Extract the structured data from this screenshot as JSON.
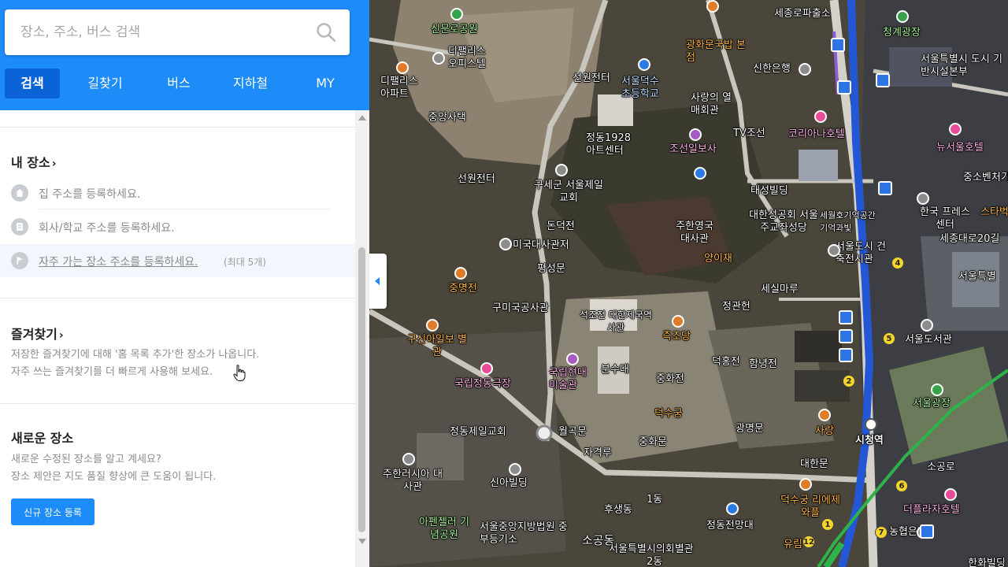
{
  "search": {
    "placeholder": "장소, 주소, 버스 검색"
  },
  "tabs": [
    {
      "label": "검색",
      "active": true
    },
    {
      "label": "길찾기"
    },
    {
      "label": "버스"
    },
    {
      "label": "지하철"
    },
    {
      "label": "MY"
    }
  ],
  "my_places": {
    "title": "내 장소",
    "items": [
      {
        "icon": "home-icon",
        "text": "집 주소를 등록하세요."
      },
      {
        "icon": "office-icon",
        "text": "회사/학교 주소를 등록하세요."
      },
      {
        "icon": "flag-icon",
        "text": "자주 가는 장소 주소를 등록하세요.",
        "count": "(최대 5개)"
      }
    ]
  },
  "favorites": {
    "title": "즐겨찾기",
    "desc1": "저장한 즐겨찾기에 대해 '홈 목록 추가'한 장소가 나옵니다.",
    "desc2": "자주 쓰는 즐겨찾기를 더 빠르게 사용해 보세요."
  },
  "new_place": {
    "title": "새로운 장소",
    "desc1": "새로운 수정된 장소를 알고 계세요?",
    "desc2": "장소 제안은 지도 품질 향상에 큰 도움이 됩니다.",
    "button": "신규 장소 등록"
  },
  "colors": {
    "brand": "#1d8bf8",
    "active_tab": "#0b63d8"
  },
  "map_labels": [
    "신문로공원",
    "디팰리스 오피스텔",
    "디팰리스 아파트",
    "중앙사택",
    "경희궁의 아침",
    "선원전터",
    "서울덕수 초등학교",
    "사랑의 열매회관",
    "신한은행",
    "세종로파출소",
    "청계광장",
    "서울특별시 도시 기반시설본부",
    "광화문국밥 본점",
    "정동1928 아트센터",
    "조선일보사",
    "TV조선",
    "코리아나호텔",
    "뉴서울호텔",
    "구세군 서울제일교회",
    "고종의길",
    "태성빌딩",
    "대한성공회 서울주교좌성당",
    "세월호기억공간 기억과빛",
    "서울도시 건축전시관",
    "한국 프레스센터",
    "세종대로20길",
    "서울특별",
    "중소벤처기",
    "스타벅스",
    "돈덕전",
    "주한영국 대사관",
    "양이재",
    "미국대사관저",
    "평성문",
    "중명전",
    "세실마루",
    "정관헌",
    "구미국공사관",
    "석조전 대한제국역사관",
    "즉조당",
    "세종대로",
    "서울도서관",
    "구신아일보 별관",
    "국립정동극장",
    "국립현대 미술관",
    "분수대",
    "덕홍전",
    "함녕전",
    "중화전",
    "서울광장",
    "정동제일교회",
    "월곡문",
    "덕수궁",
    "광명문",
    "사랑",
    "시청역",
    "자격루",
    "중화문",
    "대한문",
    "덕수궁 리에제와플",
    "소공로",
    "더플라자호텔",
    "주한러시아 대사관",
    "신아빌딩",
    "1동",
    "후생동",
    "정동전망대",
    "아펜젤러 기념공원",
    "서울중앙지방법원 중부등기소",
    "소공동",
    "서울특별시의회별관",
    "2동",
    "유림",
    "농협은행",
    "한화빌딩"
  ]
}
